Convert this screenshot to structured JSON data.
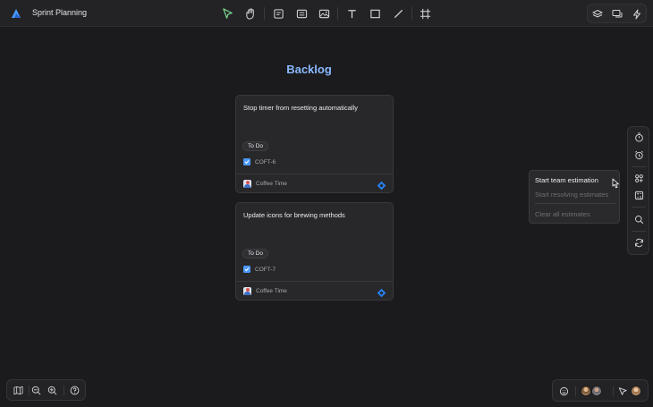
{
  "header": {
    "board_title": "Sprint Planning",
    "tools": [
      {
        "icon": "select-arrow-icon",
        "active": true
      },
      {
        "icon": "hand-icon"
      },
      {
        "icon": "sticky-note-icon"
      },
      {
        "icon": "card-icon"
      },
      {
        "icon": "image-icon"
      },
      {
        "icon": "text-icon"
      },
      {
        "icon": "shape-icon"
      },
      {
        "icon": "line-icon"
      },
      {
        "icon": "frame-icon"
      }
    ],
    "right_icons": [
      "layers-icon",
      "comments-icon",
      "lightning-icon"
    ]
  },
  "frame": {
    "title": "Backlog"
  },
  "cards": [
    {
      "title": "Stop timer from resetting automatically",
      "status": "To Do",
      "issue_key": "COFT-6",
      "project": "Coffee Time"
    },
    {
      "title": "Update icons for brewing methods",
      "status": "To Do",
      "issue_key": "COFT-7",
      "project": "Coffee Time"
    }
  ],
  "estimation_menu": {
    "items": [
      {
        "label": "Start team estimation",
        "enabled": true
      },
      {
        "label": "Start resolving estimates",
        "enabled": false
      },
      {
        "label": "Clear all estimates",
        "enabled": false
      }
    ]
  },
  "side_toolbar": [
    "timer-icon",
    "alarm-icon",
    "apps-icon",
    "estimation-icon",
    "search-icon",
    "sync-icon"
  ],
  "bottom_left_tools": [
    "map-icon",
    "zoom-out-icon",
    "zoom-in-icon",
    "help-icon"
  ],
  "colors": {
    "accent": "#4c9aff",
    "frame_title": "#8ab8ff",
    "active_tool": "#7bd88f"
  }
}
